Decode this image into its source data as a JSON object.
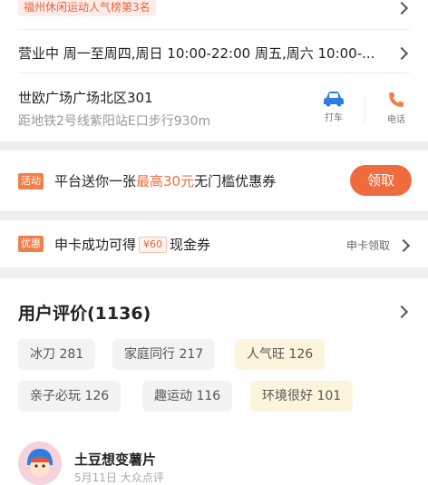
{
  "rank": {
    "badge": "福州休闲运动人气榜第3名"
  },
  "hours": {
    "text": "营业中  周一至周四,周日 10:00-22:00  周五,周六 10:00-..."
  },
  "address": {
    "title": "世欧广场广场北区301",
    "subtitle": "距地铁2号线紫阳站E口步行930m",
    "actions": [
      {
        "label": "打车",
        "icon": "car-icon"
      },
      {
        "label": "电话",
        "icon": "phone-icon"
      }
    ]
  },
  "promo": {
    "tag": "活动",
    "text_prefix": "平台送你一张",
    "text_highlight": "最高30元",
    "text_suffix": "无门槛优惠券",
    "button": "领取"
  },
  "card": {
    "tag": "优惠",
    "text_prefix": "申卡成功可得",
    "amount": "¥60",
    "text_suffix": "现金券",
    "action": "申卡领取"
  },
  "reviews": {
    "title": "用户评价(1136)",
    "chips": [
      {
        "label": "冰刀 281",
        "hot": false
      },
      {
        "label": "家庭同行 217",
        "hot": false
      },
      {
        "label": "人气旺 126",
        "hot": true
      },
      {
        "label": "亲子必玩 126",
        "hot": false
      },
      {
        "label": "趣运动 116",
        "hot": false
      },
      {
        "label": "环境很好 101",
        "hot": true
      }
    ],
    "first": {
      "name": "土豆想变薯片",
      "date": "5月11日  大众点评"
    }
  },
  "colors": {
    "accent": "#f06b3d",
    "icon_blue": "#2c7fe0",
    "icon_orange": "#f07f4a",
    "section_gap": "#eeeeee"
  }
}
